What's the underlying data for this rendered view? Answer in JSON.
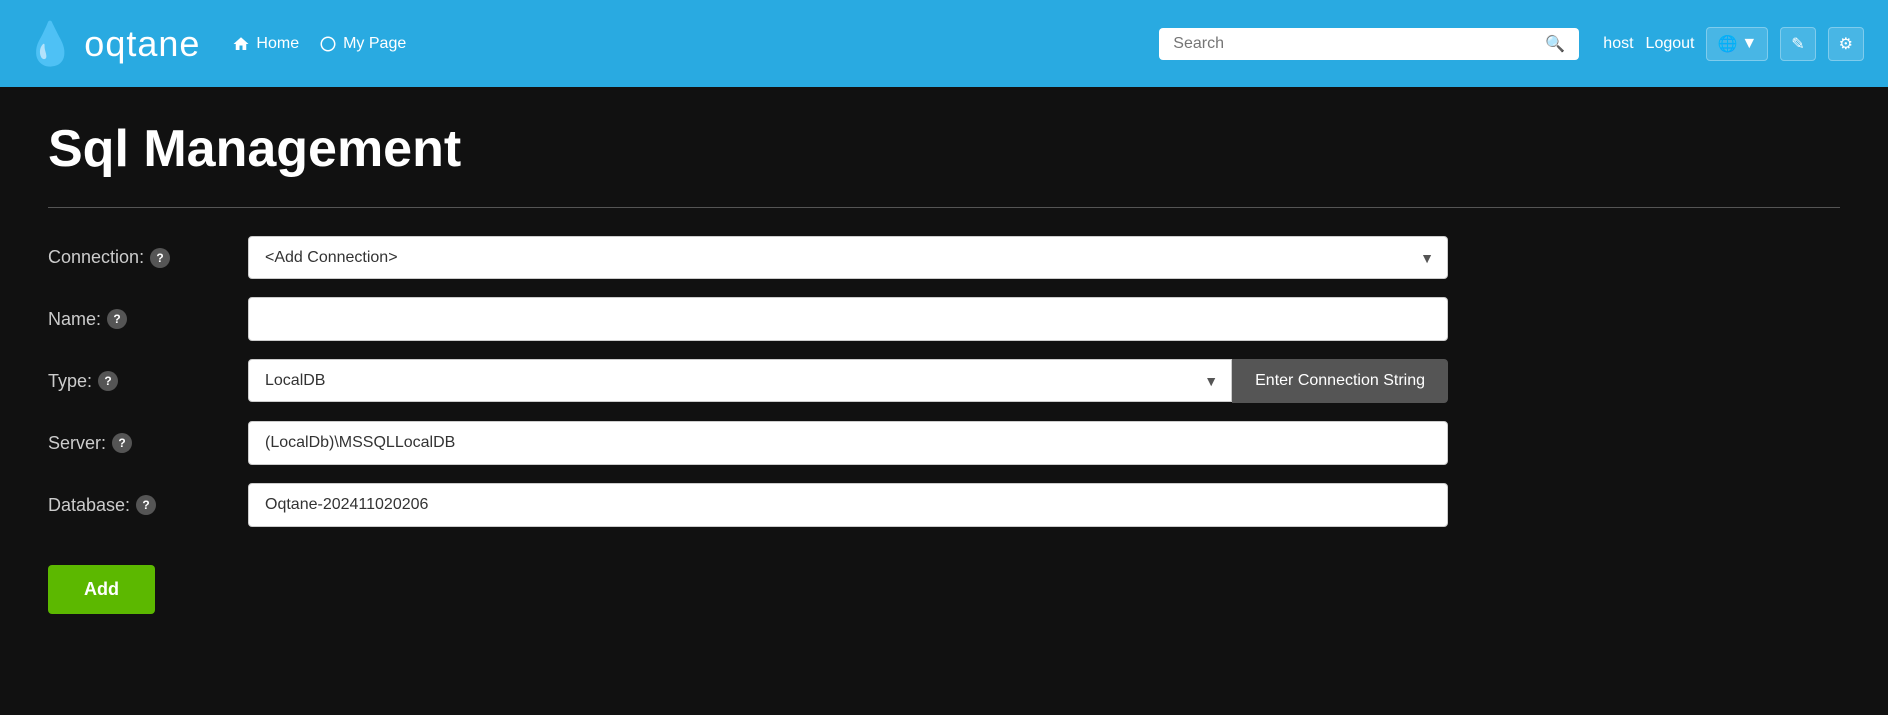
{
  "brand": {
    "name": "oqtane",
    "logo_icon": "💧"
  },
  "navbar": {
    "home_label": "Home",
    "mypage_label": "My Page",
    "search_placeholder": "Search",
    "username": "host",
    "logout_label": "Logout",
    "globe_icon": "🌐",
    "pencil_icon": "✏",
    "gear_icon": "⚙"
  },
  "page": {
    "title": "Sql Management"
  },
  "form": {
    "connection_label": "Connection:",
    "connection_options": [
      "<Add Connection>"
    ],
    "connection_selected": "<Add Connection>",
    "name_label": "Name:",
    "name_value": "",
    "name_placeholder": "",
    "type_label": "Type:",
    "type_options": [
      "LocalDB"
    ],
    "type_selected": "LocalDB",
    "enter_connection_string_label": "Enter Connection String",
    "server_label": "Server:",
    "server_value": "(LocalDb)\\MSSQLLocalDB",
    "database_label": "Database:",
    "database_value": "Oqtane-202411020206",
    "add_button_label": "Add"
  }
}
